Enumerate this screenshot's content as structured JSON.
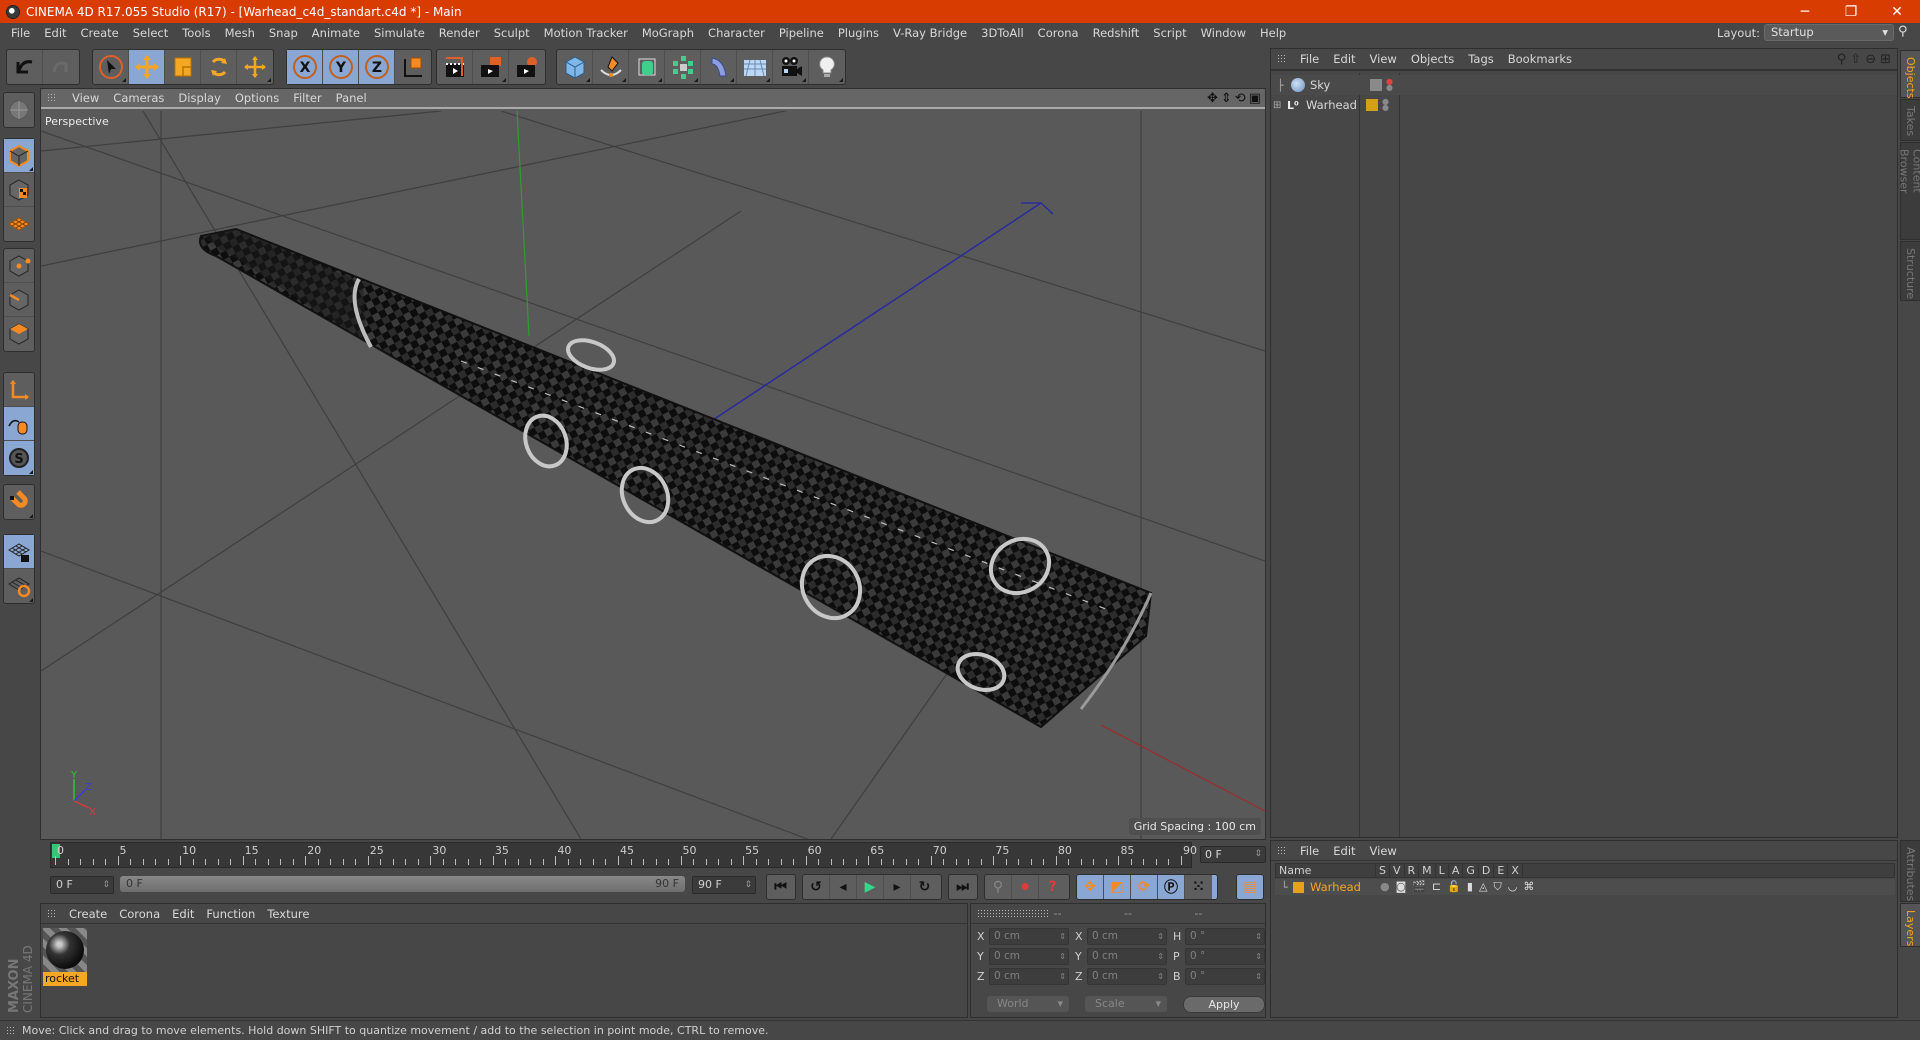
{
  "window": {
    "title": "CINEMA 4D R17.055 Studio (R17) - [Warhead_c4d_standart.c4d *] - Main",
    "controls": {
      "minimize": "─",
      "restore": "❐",
      "close": "✕"
    }
  },
  "menubar": {
    "items": [
      "File",
      "Edit",
      "Create",
      "Select",
      "Tools",
      "Mesh",
      "Snap",
      "Animate",
      "Simulate",
      "Render",
      "Sculpt",
      "Motion Tracker",
      "MoGraph",
      "Character",
      "Pipeline",
      "Plugins",
      "V-Ray Bridge",
      "3DToAll",
      "Corona",
      "Redshift",
      "Script",
      "Window",
      "Help"
    ],
    "layout_label": "Layout:",
    "layout_value": "Startup"
  },
  "toolbar": {
    "groups": [
      {
        "name": "history",
        "buttons": [
          "undo-icon",
          "redo-icon"
        ]
      },
      {
        "name": "tools",
        "buttons": [
          "select-arrow-icon",
          "move-icon",
          "scale-icon",
          "rotate-icon",
          "live-move-icon"
        ]
      },
      {
        "name": "axis",
        "buttons": [
          "x-axis-lock-icon",
          "y-axis-lock-icon",
          "z-axis-lock-icon",
          "coordinate-system-icon"
        ]
      },
      {
        "name": "render",
        "buttons": [
          "render-view-icon",
          "render-picture-viewer-icon",
          "render-settings-icon"
        ]
      },
      {
        "name": "create",
        "buttons": [
          "cube-primitive-icon",
          "pen-spline-icon",
          "subdivision-surface-icon",
          "cloner-array-icon",
          "bend-deformer-icon",
          "floor-environment-icon",
          "camera-icon",
          "light-icon"
        ]
      }
    ]
  },
  "left_palette": {
    "buttons": [
      "make-editable-icon",
      "model-mode-icon",
      "texture-mode-icon",
      "workplane-mode-icon",
      "points-mode-icon",
      "edges-mode-icon",
      "polygons-mode-icon",
      "axis-mode-icon",
      "tweak-mode-icon",
      "solo-mode-icon",
      "snap-magnet-icon",
      "workplane-lock-icon",
      "workplane-align-icon"
    ]
  },
  "viewport": {
    "menu": [
      "View",
      "Cameras",
      "Display",
      "Options",
      "Filter",
      "Panel"
    ],
    "label": "Perspective",
    "grid_spacing": "Grid Spacing : 100 cm",
    "axis_labels": {
      "x": "X",
      "y": "Y",
      "z": "Z"
    }
  },
  "timeline": {
    "ticks": [
      "0",
      "5",
      "10",
      "15",
      "20",
      "25",
      "30",
      "35",
      "40",
      "45",
      "50",
      "55",
      "60",
      "65",
      "70",
      "75",
      "80",
      "85",
      "90"
    ],
    "current_frame": "0 F",
    "start_field": "0 F",
    "range_start": "0 F",
    "range_end": "90 F",
    "end_field": "90 F"
  },
  "transport": {
    "buttons": [
      "go-to-start-icon",
      "previous-key-icon",
      "previous-frame-icon",
      "play-icon",
      "next-frame-icon",
      "next-key-icon",
      "go-to-end-icon",
      "record-keys-icon",
      "autokeying-icon",
      "keyframe-selection-icon",
      "key-position-icon",
      "key-scale-icon",
      "key-rotation-icon",
      "key-parameter-icon",
      "key-pla-icon",
      "timeline-icon"
    ]
  },
  "material_manager": {
    "menu": [
      "Create",
      "Corona",
      "Edit",
      "Function",
      "Texture"
    ],
    "materials": [
      {
        "name": "rocket"
      }
    ]
  },
  "coordinates": {
    "headers": [
      "--",
      "--",
      "--"
    ],
    "position": [
      {
        "label": "X",
        "value": "0 cm"
      },
      {
        "label": "Y",
        "value": "0 cm"
      },
      {
        "label": "Z",
        "value": "0 cm"
      }
    ],
    "size": [
      {
        "label": "X",
        "value": "0 cm"
      },
      {
        "label": "Y",
        "value": "0 cm"
      },
      {
        "label": "Z",
        "value": "0 cm"
      }
    ],
    "rotation": [
      {
        "label": "H",
        "value": "0 °"
      },
      {
        "label": "P",
        "value": "0 °"
      },
      {
        "label": "B",
        "value": "0 °"
      }
    ],
    "mode_dropdown": "World",
    "size_dropdown": "Scale",
    "apply_label": "Apply"
  },
  "object_manager": {
    "menu": [
      "File",
      "Edit",
      "View",
      "Objects",
      "Tags",
      "Bookmarks"
    ],
    "objects": [
      {
        "name": "Sky",
        "icon": "sky-icon",
        "color": "#8a8a8a"
      },
      {
        "name": "Warhead",
        "icon": "null-object-icon",
        "color": "#d4a017"
      }
    ]
  },
  "layer_manager": {
    "menu": [
      "File",
      "Edit",
      "View"
    ],
    "columns": [
      "Name",
      "S",
      "V",
      "R",
      "M",
      "L",
      "A",
      "G",
      "D",
      "E",
      "X"
    ],
    "layers": [
      {
        "name": "Warhead",
        "color": "#e8a21a"
      }
    ]
  },
  "side_tabs": {
    "top": [
      "Objects",
      "Takes",
      "Content Browser",
      "Structure"
    ],
    "bottom": [
      "Attributes",
      "Layers"
    ]
  },
  "statusbar": {
    "text": "Move: Click and drag to move elements. Hold down SHIFT to quantize movement / add to the selection in point mode, CTRL to remove."
  },
  "branding": {
    "line1": "MAXON",
    "line2": "CINEMA 4D"
  },
  "colors": {
    "titlebar": "#d93c00",
    "accent_orange": "#f5a623",
    "active_blue": "#8aa7d3"
  }
}
